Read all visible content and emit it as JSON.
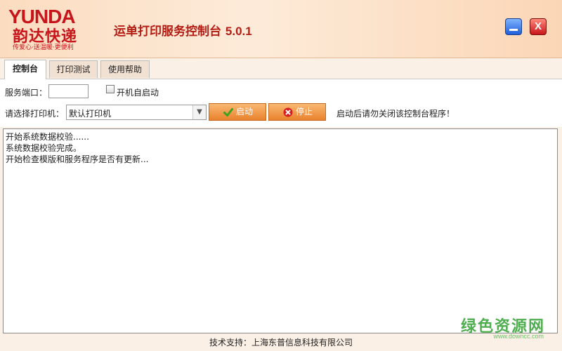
{
  "brand": {
    "logo_en": "YUNDA",
    "logo_cn": "韵达快递",
    "slogan": "传爱心·送温暖·更便利"
  },
  "app": {
    "title": "运单打印服务控制台",
    "version": "5.0.1"
  },
  "window_controls": {
    "close_label": "X"
  },
  "tabs": [
    {
      "label": "控制台",
      "active": true
    },
    {
      "label": "打印测试",
      "active": false
    },
    {
      "label": "使用帮助",
      "active": false
    }
  ],
  "form": {
    "port_label": "服务端口：",
    "port_value": "",
    "autostart_label": "开机自启动",
    "autostart_checked": false,
    "printer_label": "请选择打印机：",
    "printer_value": "默认打印机",
    "start_label": "启动",
    "stop_label": "停止",
    "notice": "启动后请勿关闭该控制台程序！"
  },
  "log": [
    "开始系统数据校验......",
    "系统数据校验完成。",
    "开始检查模版和服务程序是否有更新..."
  ],
  "footer": {
    "support": "技术支持：上海东普信息科技有限公司"
  },
  "watermark": {
    "text": "绿色资源网",
    "url": "www.downcc.com"
  },
  "colors": {
    "brand_red": "#c8151b",
    "button_orange": "#e9822e",
    "header_bg": "#fbdcc0"
  }
}
